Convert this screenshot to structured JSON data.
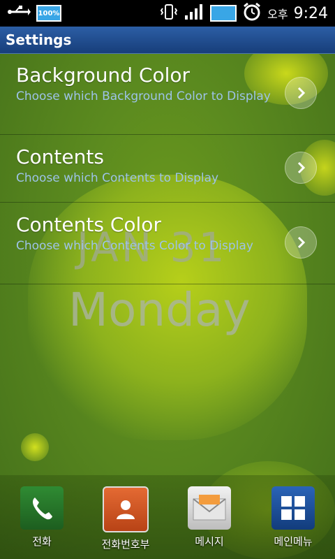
{
  "status_bar": {
    "battery_percent": "100%",
    "ampm": "오후",
    "time": "9:24",
    "icons": [
      "usb-icon",
      "battery-icon",
      "vibrate-icon",
      "signal-icon",
      "battery-level-icon",
      "alarm-icon"
    ]
  },
  "wallpaper": {
    "date": "JAN 31",
    "day": "Monday"
  },
  "title_bar": {
    "title": "Settings"
  },
  "settings": [
    {
      "title": "Background Color",
      "subtitle": "Choose which Background Color to Display"
    },
    {
      "title": "Contents",
      "subtitle": "Choose which Contents to Display"
    },
    {
      "title": "Contents Color",
      "subtitle": "Choose which Contents Color to Display"
    }
  ],
  "dock": [
    {
      "label": "전화",
      "icon": "phone-icon"
    },
    {
      "label": "전화번호부",
      "icon": "contacts-icon"
    },
    {
      "label": "메시지",
      "icon": "message-icon"
    },
    {
      "label": "메인메뉴",
      "icon": "main-menu-icon"
    }
  ],
  "colors": {
    "wallpaper_green": "#5b8a1f",
    "title_bar_blue": "#1f4c8f",
    "subtitle_blue": "#9dc3e8"
  }
}
